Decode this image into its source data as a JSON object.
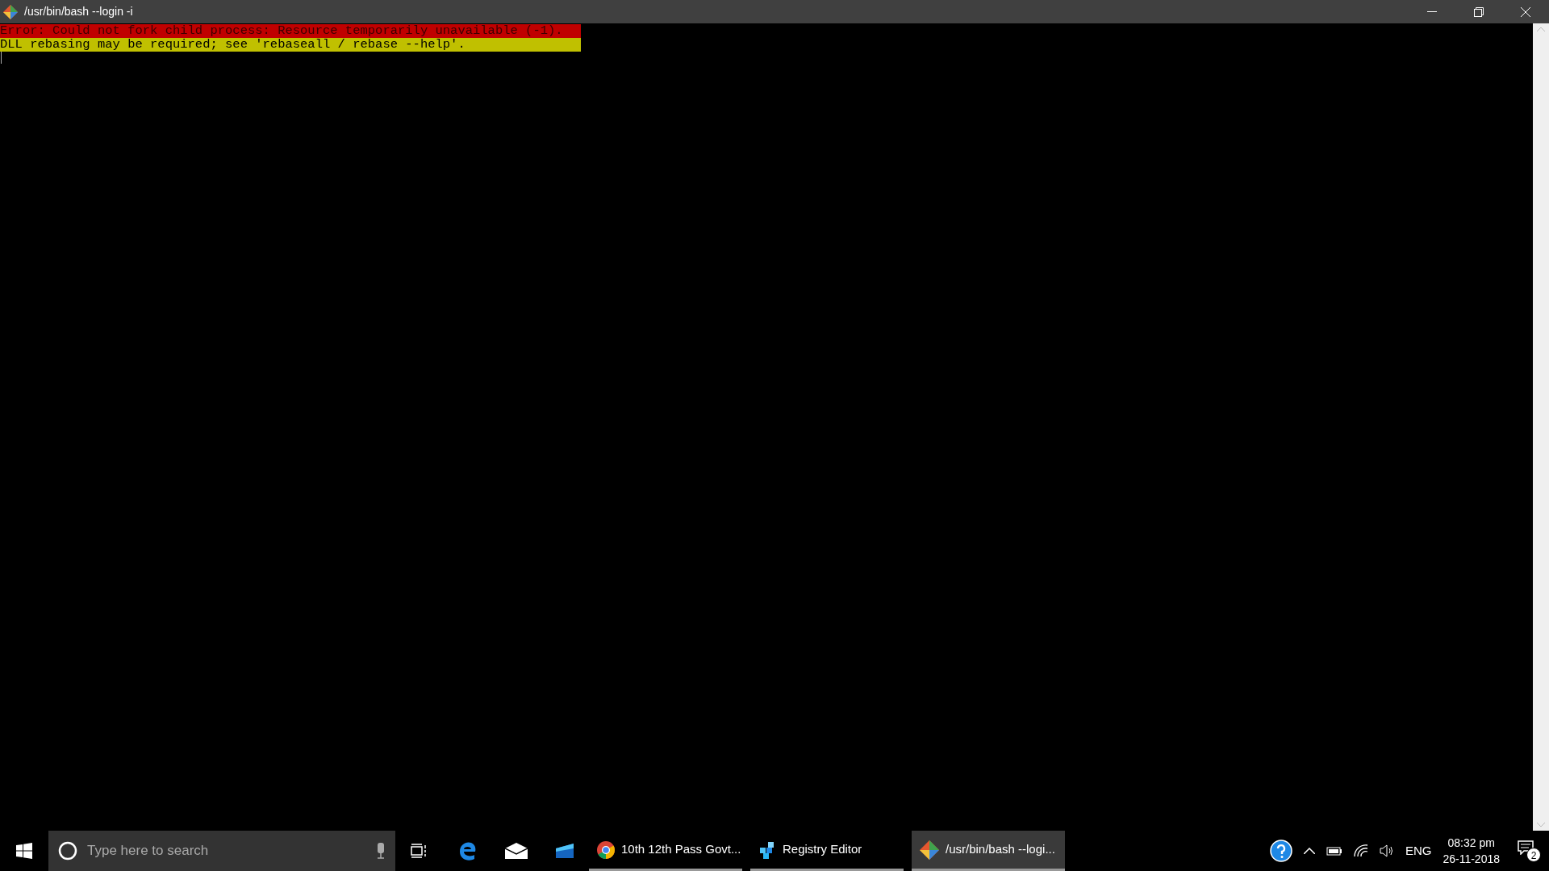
{
  "window": {
    "title": "/usr/bin/bash --login -i"
  },
  "terminal": {
    "lines": [
      {
        "kind": "error",
        "text": "Error: Could not fork child process: Resource temporarily unavailable (-1)."
      },
      {
        "kind": "warning",
        "text": "DLL rebasing may be required; see 'rebaseall / rebase --help'."
      }
    ]
  },
  "taskbar": {
    "search": {
      "placeholder": "Type here to search"
    },
    "pinned": [
      {
        "kind": "taskview"
      },
      {
        "kind": "edge"
      },
      {
        "kind": "mail"
      },
      {
        "kind": "app"
      }
    ],
    "tasks": [
      {
        "kind": "chrome",
        "label": "10th 12th Pass Govt...",
        "selected": false
      },
      {
        "kind": "registry",
        "label": "Registry Editor",
        "selected": false
      },
      {
        "kind": "git",
        "label": "/usr/bin/bash --logi...",
        "selected": true
      }
    ],
    "tray": {
      "language": "ENG",
      "time": "08:32 pm",
      "date": "26-11-2018",
      "notifications": "2"
    }
  }
}
